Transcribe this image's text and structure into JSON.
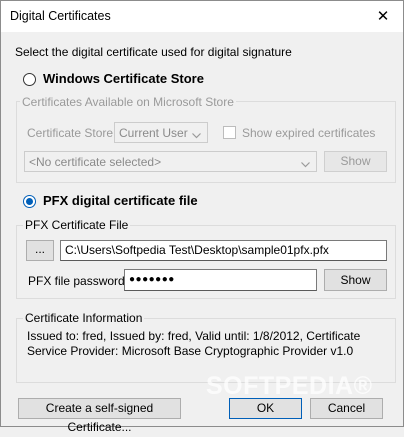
{
  "window": {
    "title": "Digital Certificates",
    "close_glyph": "✕"
  },
  "prompt": "Select the digital certificate used for digital signature",
  "windows_store": {
    "radio_label": "Windows Certificate Store",
    "group_title": "Certificates Available on Microsoft Store",
    "store_label": "Certificate Store:",
    "store_value": "Current User",
    "show_expired_label": "Show expired certificates",
    "cert_select_value": "<No certificate selected>",
    "show_button": "Show"
  },
  "pfx": {
    "radio_label": "PFX digital certificate file",
    "group_title": "PFX Certificate File",
    "browse_button": "...",
    "file_path": "C:\\Users\\Softpedia Test\\Desktop\\sample01pfx.pfx",
    "password_label": "PFX file password:",
    "password_value": "●●●●●●●",
    "show_button": "Show"
  },
  "info": {
    "group_title": "Certificate Information",
    "text": "Issued to: fred, Issued by: fred, Valid until: 1/8/2012, Certificate Service Provider: Microsoft Base Cryptographic Provider v1.0"
  },
  "buttons": {
    "self_signed": "Create a self-signed Certificate...",
    "ok": "OK",
    "cancel": "Cancel"
  },
  "watermark": "SOFTPEDIA®",
  "colors": {
    "accent": "#005fb8",
    "title_bg": "#ffffff",
    "body_bg": "#f0f0f0"
  }
}
